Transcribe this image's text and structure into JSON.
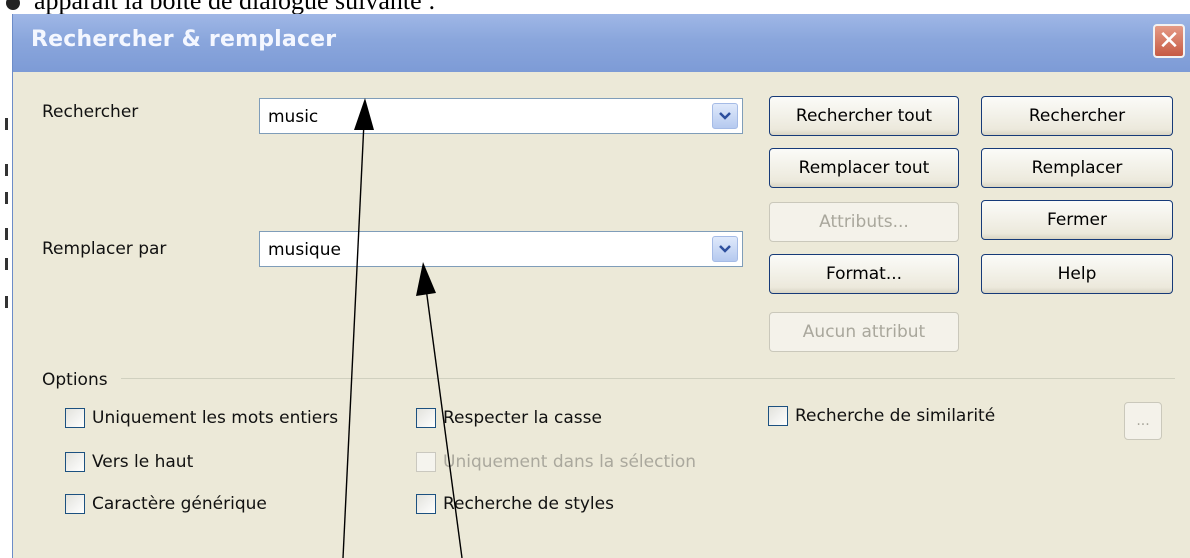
{
  "document": {
    "caption": "apparaît la boîte de dialogue suivante :"
  },
  "dialog": {
    "title": "Rechercher & remplacer",
    "close_glyph": "✕",
    "search": {
      "label": "Rechercher",
      "value": "music"
    },
    "replace": {
      "label": "Remplacer par",
      "value": "musique"
    },
    "buttons": {
      "search_all": "Rechercher tout",
      "search": "Rechercher",
      "replace_all": "Remplacer tout",
      "replace": "Remplacer",
      "attributes": "Attributs...",
      "close": "Fermer",
      "format": "Format...",
      "help": "Help",
      "no_attribute": "Aucun attribut",
      "more": "..."
    },
    "options": {
      "legend": "Options",
      "whole_words": "Uniquement les mots entiers",
      "match_case": "Respecter la casse",
      "similarity": "Recherche de similarité",
      "backwards": "Vers le haut",
      "selection_only": "Uniquement dans la sélection",
      "regex": "Caractère générique",
      "styles": "Recherche de styles"
    }
  },
  "colors": {
    "titlebar": "#8aa6dc",
    "dialog_bg": "#ece9d8",
    "button_border": "#163a78",
    "close": "#c65b44"
  }
}
